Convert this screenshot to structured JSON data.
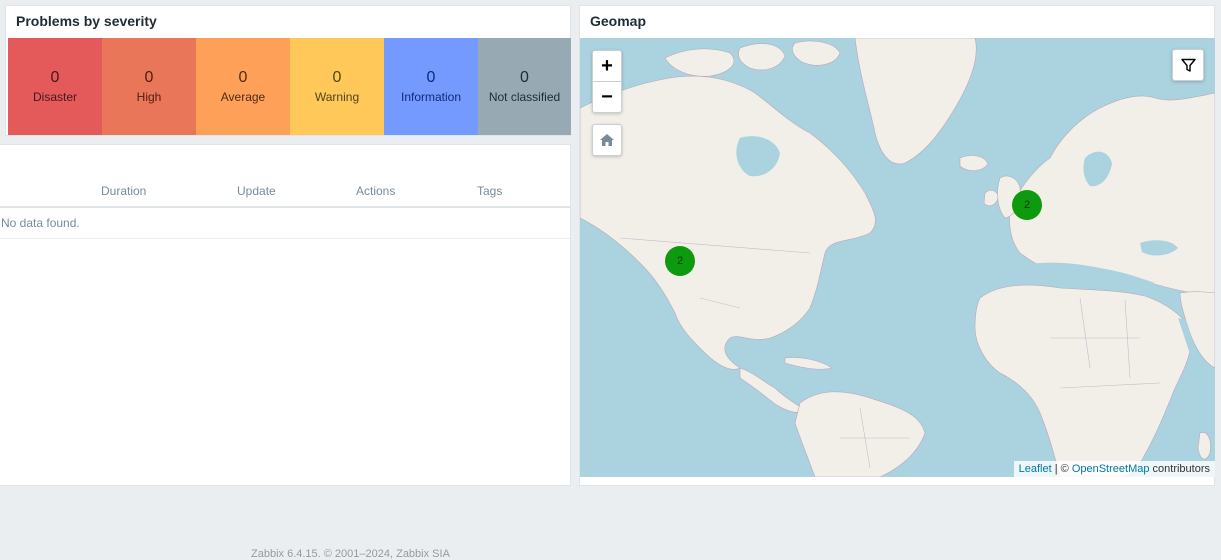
{
  "severity_widget": {
    "title": "Problems by severity",
    "items": [
      {
        "count": "0",
        "label": "Disaster",
        "bg": "#e45959",
        "fg": "#44191a"
      },
      {
        "count": "0",
        "label": "High",
        "bg": "#e97659",
        "fg": "#4f1d11"
      },
      {
        "count": "0",
        "label": "Average",
        "bg": "#ffa059",
        "fg": "#4f2b0f"
      },
      {
        "count": "0",
        "label": "Warning",
        "bg": "#ffc859",
        "fg": "#51431c"
      },
      {
        "count": "0",
        "label": "Information",
        "bg": "#7499ff",
        "fg": "#102a78"
      },
      {
        "count": "0",
        "label": "Not classified",
        "bg": "#97aab3",
        "fg": "#1f2c33"
      }
    ]
  },
  "problems_widget": {
    "columns": [
      "Duration",
      "Update",
      "Actions",
      "Tags"
    ],
    "empty_text": "No data found."
  },
  "geomap_widget": {
    "title": "Geomap",
    "zoom_in": "+",
    "zoom_out": "−",
    "clusters": [
      "2",
      "2"
    ],
    "cluster_color": "#0e9a0e",
    "attribution": {
      "leaflet": "Leaflet",
      "sep": " | © ",
      "osm": "OpenStreetMap",
      "suffix": " contributors"
    }
  },
  "footer": {
    "text": "Zabbix 6.4.15. © 2001–2024, Zabbix SIA"
  }
}
